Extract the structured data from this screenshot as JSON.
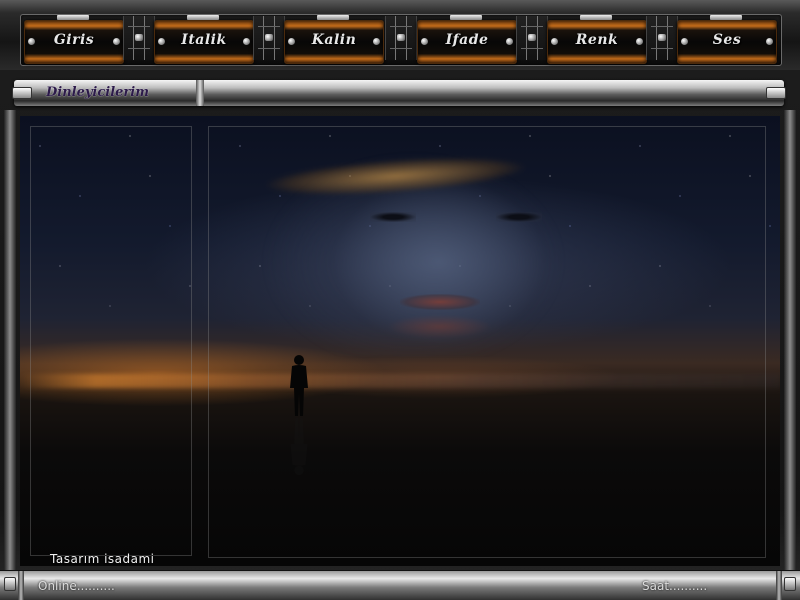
{
  "nav": {
    "items": [
      {
        "label": "Giris"
      },
      {
        "label": "Italik"
      },
      {
        "label": "Kalin"
      },
      {
        "label": "Ifade"
      },
      {
        "label": "Renk"
      },
      {
        "label": "Ses"
      }
    ]
  },
  "titlebar": {
    "title": "Dinleyicilerim"
  },
  "main": {
    "design_credit": "Tasarım isadami"
  },
  "footer": {
    "online": "Online..........",
    "saat": "Saat.........."
  },
  "colors": {
    "accent_orange": "#c36b1a",
    "title_text": "#2c1a4a",
    "chrome": "#bdbdbd"
  }
}
